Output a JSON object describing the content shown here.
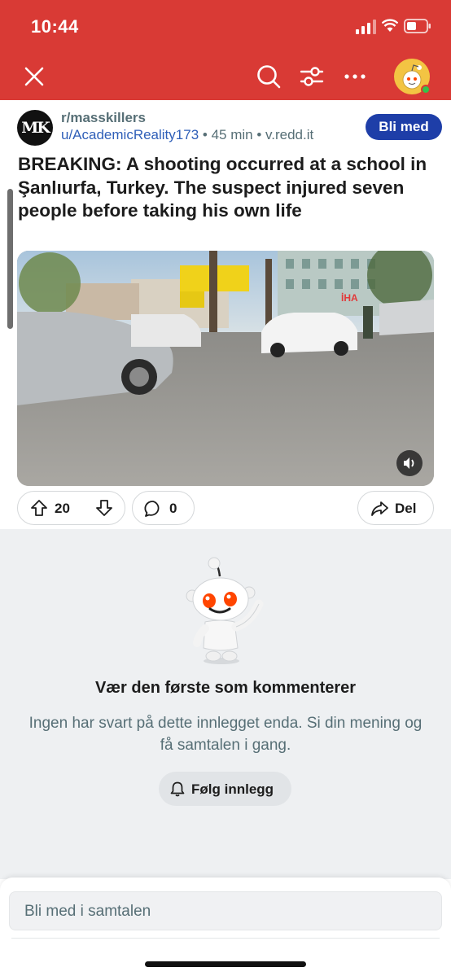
{
  "status_bar": {
    "time": "10:44"
  },
  "navbar": {
    "close_icon": "close-icon",
    "search_icon": "search-icon",
    "filter_icon": "sliders-icon",
    "more_icon": "more-icon",
    "avatar_icon": "snoo-avatar"
  },
  "post": {
    "subreddit": "r/masskillers",
    "subreddit_avatar_text": "MK",
    "author": "u/AcademicReality173",
    "time": "• 45 min •",
    "domain": "v.redd.it",
    "join_label": "Bli med",
    "title": "BREAKING: A shooting occurred at a school in Şanlıurfa, Turkey. The suspect injured seven people before taking his own life",
    "video": {
      "sign_text": "İHA",
      "mute_icon": "sound-icon"
    }
  },
  "actions": {
    "upvote_count": "20",
    "comment_count": "0",
    "share_label": "Del"
  },
  "empty_state": {
    "title": "Vær den første som kommenterer",
    "subtitle": "Ingen har svart på dette innlegget enda. Si din mening og få samtalen i gang.",
    "follow_label": "Følg innlegg"
  },
  "composer": {
    "placeholder": "Bli med i samtalen"
  },
  "colors": {
    "brand_red": "#d93a35",
    "join_blue": "#1e3ea8",
    "link_blue": "#2f5fb8"
  }
}
